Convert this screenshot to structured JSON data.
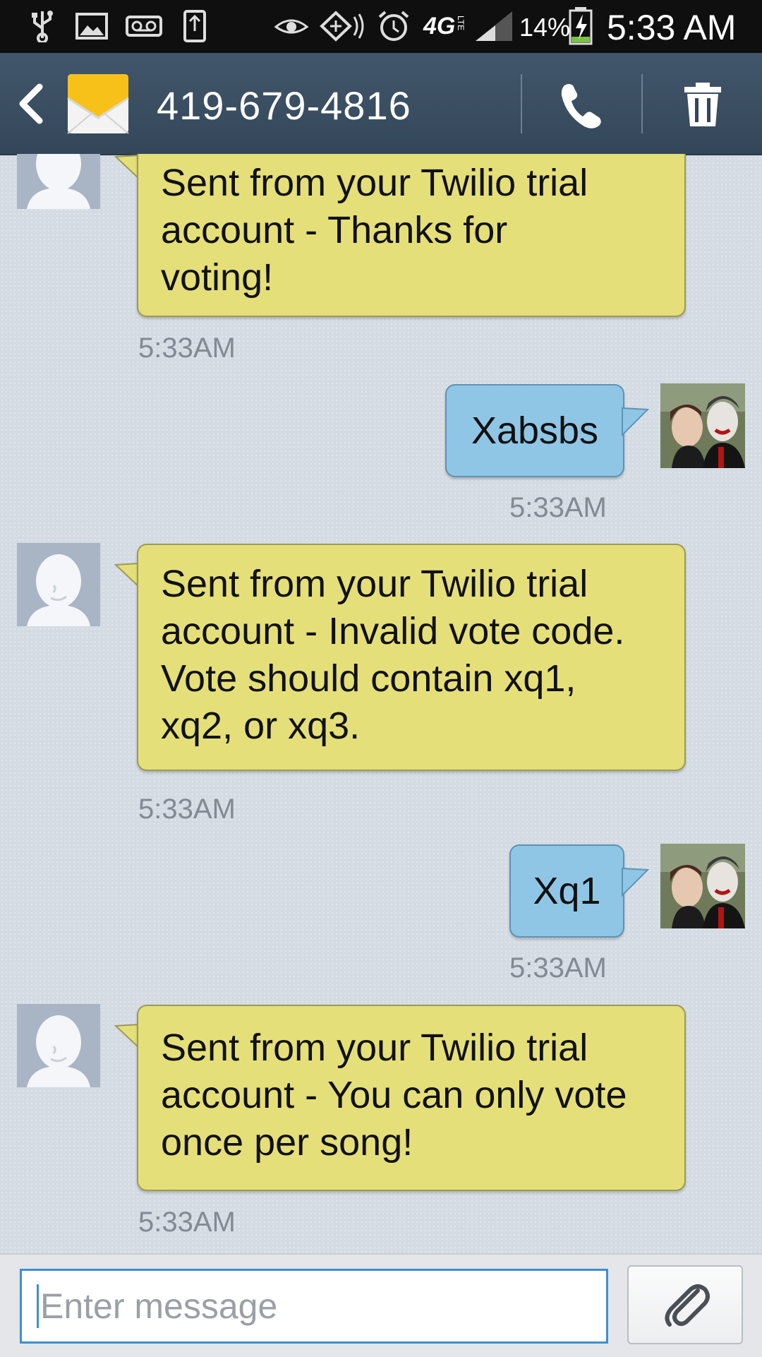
{
  "status_bar": {
    "battery_percent": "14%",
    "network": "4G",
    "network_sub": "LTE",
    "time": "5:33 AM"
  },
  "header": {
    "contact": "419-679-4816",
    "icons": [
      "back-arrow-icon",
      "envelope-icon",
      "phone-icon",
      "trash-icon"
    ]
  },
  "messages": [
    {
      "direction": "in",
      "lines": [
        "Sent from your Twilio trial",
        "account - Thanks for",
        "voting!"
      ],
      "time": "5:33AM"
    },
    {
      "direction": "out",
      "lines": [
        "Xabsbs"
      ],
      "time": "5:33AM"
    },
    {
      "direction": "in",
      "lines": [
        "Sent from your Twilio trial",
        "account - Invalid vote code.",
        "Vote should contain xq1,",
        "xq2, or xq3."
      ],
      "time": "5:33AM"
    },
    {
      "direction": "out",
      "lines": [
        "Xq1"
      ],
      "time": "5:33AM"
    },
    {
      "direction": "in",
      "lines": [
        "Sent from your Twilio trial",
        "account - You can only vote",
        "once per song!"
      ],
      "time": "5:33AM"
    }
  ],
  "composer": {
    "placeholder": "Enter message",
    "attach_icon": "paperclip-icon"
  },
  "colors": {
    "incoming_bubble": "#e5df7a",
    "outgoing_bubble": "#8fc6e6",
    "action_bar": "#3b4f63",
    "input_focus": "#3f8fd0"
  }
}
